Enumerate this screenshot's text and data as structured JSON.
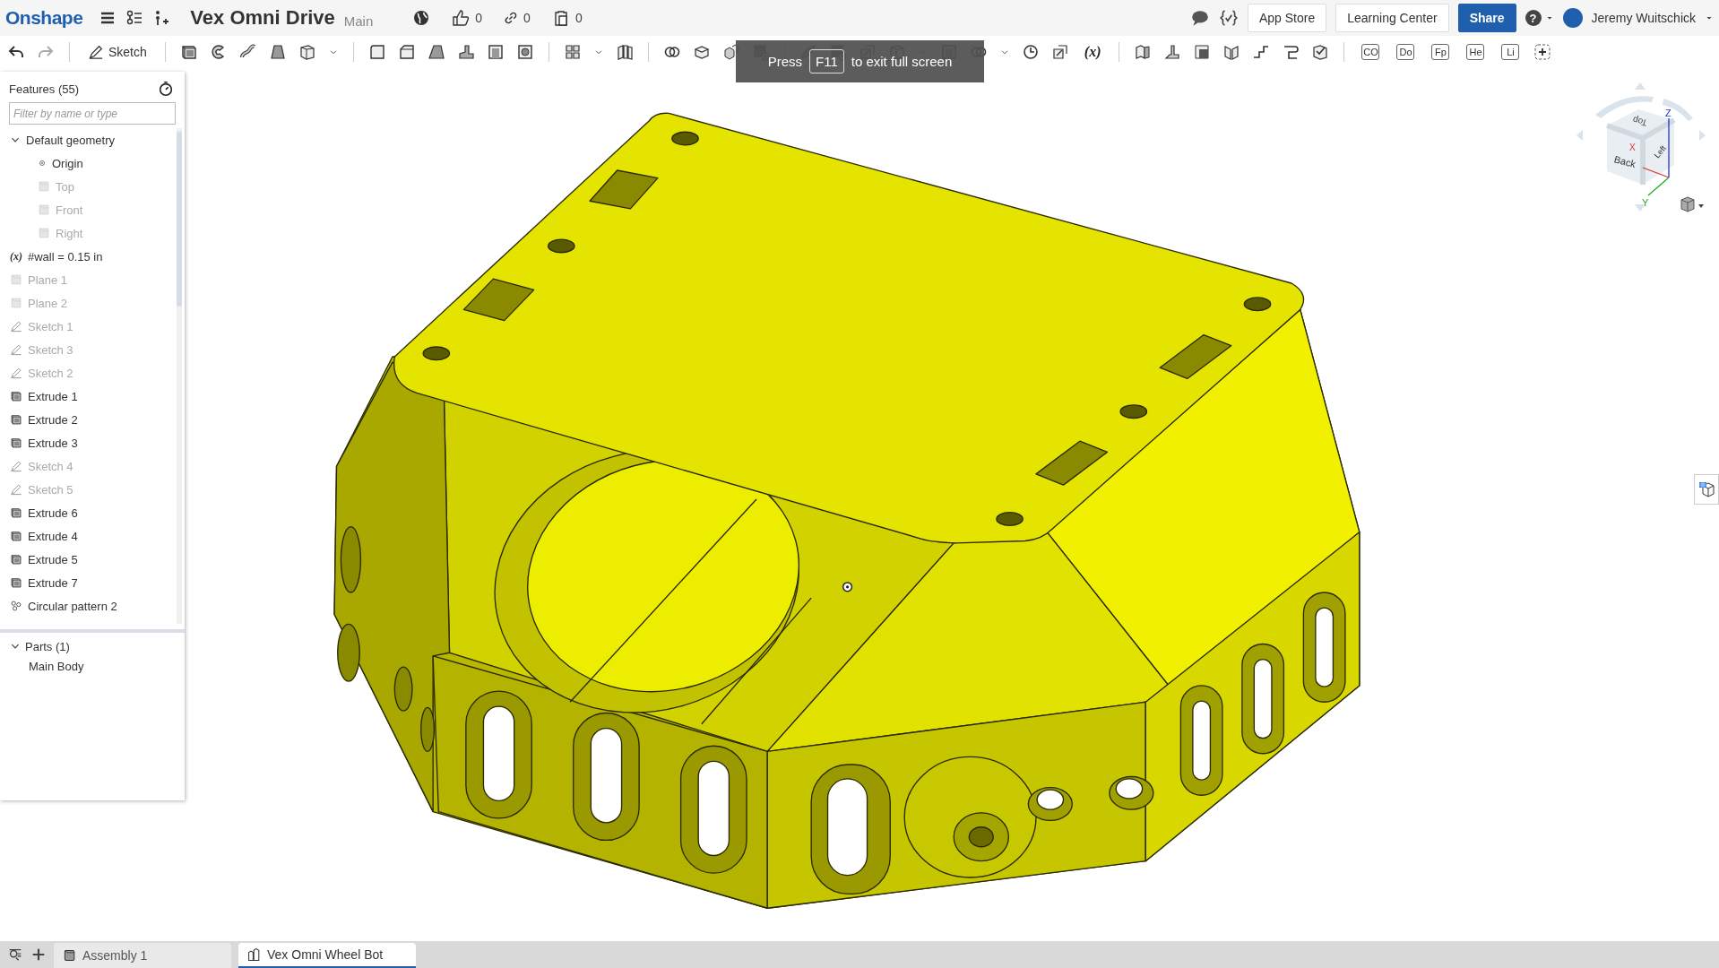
{
  "topbar": {
    "logo": "Onshape",
    "document_title": "Vex Omni Drive",
    "branch": "Main",
    "likes": "0",
    "links": "0",
    "copies": "0",
    "buttons": [
      {
        "label": "App Store",
        "kind": "plain"
      },
      {
        "label": "Learning Center",
        "kind": "plain"
      },
      {
        "label": "Share",
        "kind": "primary"
      }
    ],
    "help": "?",
    "user": "Jeremy Wuitschick"
  },
  "toolbar": {
    "sketch": "Sketch",
    "variable": "(x)",
    "custom_features": [
      "CO",
      "Do",
      "Fp",
      "He",
      "Li"
    ]
  },
  "tooltip": {
    "before": "Press",
    "key": "F11",
    "after": "to exit full screen"
  },
  "feature_panel": {
    "title": "Features (55)",
    "filter": {
      "placeholder": "Filter by name or type"
    },
    "features": [
      {
        "label": "Default geometry",
        "kind": "group",
        "expanded": true,
        "children": [
          {
            "label": "Origin",
            "kind": "origin",
            "hidden": false
          },
          {
            "label": "Top",
            "kind": "plane",
            "hidden": true
          },
          {
            "label": "Front",
            "kind": "plane",
            "hidden": true
          },
          {
            "label": "Right",
            "kind": "plane",
            "hidden": true
          }
        ]
      },
      {
        "label": "#wall = 0.15 in",
        "kind": "variable",
        "symbol": "(x)",
        "hidden": false
      },
      {
        "label": "Plane 1",
        "kind": "plane",
        "hidden": true
      },
      {
        "label": "Plane 2",
        "kind": "plane",
        "hidden": true
      },
      {
        "label": "Sketch 1",
        "kind": "sketch",
        "hidden": true
      },
      {
        "label": "Sketch 3",
        "kind": "sketch",
        "hidden": true
      },
      {
        "label": "Sketch 2",
        "kind": "sketch",
        "hidden": true
      },
      {
        "label": "Extrude 1",
        "kind": "extrude",
        "hidden": false
      },
      {
        "label": "Extrude 2",
        "kind": "extrude",
        "hidden": false
      },
      {
        "label": "Extrude 3",
        "kind": "extrude",
        "hidden": false
      },
      {
        "label": "Sketch 4",
        "kind": "sketch",
        "hidden": true
      },
      {
        "label": "Sketch 5",
        "kind": "sketch",
        "hidden": true
      },
      {
        "label": "Extrude 6",
        "kind": "extrude",
        "hidden": false
      },
      {
        "label": "Extrude 4",
        "kind": "extrude",
        "hidden": false
      },
      {
        "label": "Extrude 5",
        "kind": "extrude",
        "hidden": false
      },
      {
        "label": "Extrude 7",
        "kind": "extrude",
        "hidden": false
      },
      {
        "label": "Circular pattern 2",
        "kind": "pattern",
        "hidden": false
      }
    ],
    "parts": {
      "title": "Parts (1)",
      "expanded": true,
      "items": [
        "Main Body"
      ]
    }
  },
  "view_cube": {
    "top": "Top",
    "back": "Back",
    "left": "Left",
    "x_axis": "X",
    "y_axis": "Y",
    "z_axis": "Z"
  },
  "tabs": [
    {
      "label": "Assembly 1",
      "kind": "assembly",
      "selected": false
    },
    {
      "label": "Vex Omni Wheel Bot",
      "kind": "partstudio",
      "selected": true
    }
  ]
}
